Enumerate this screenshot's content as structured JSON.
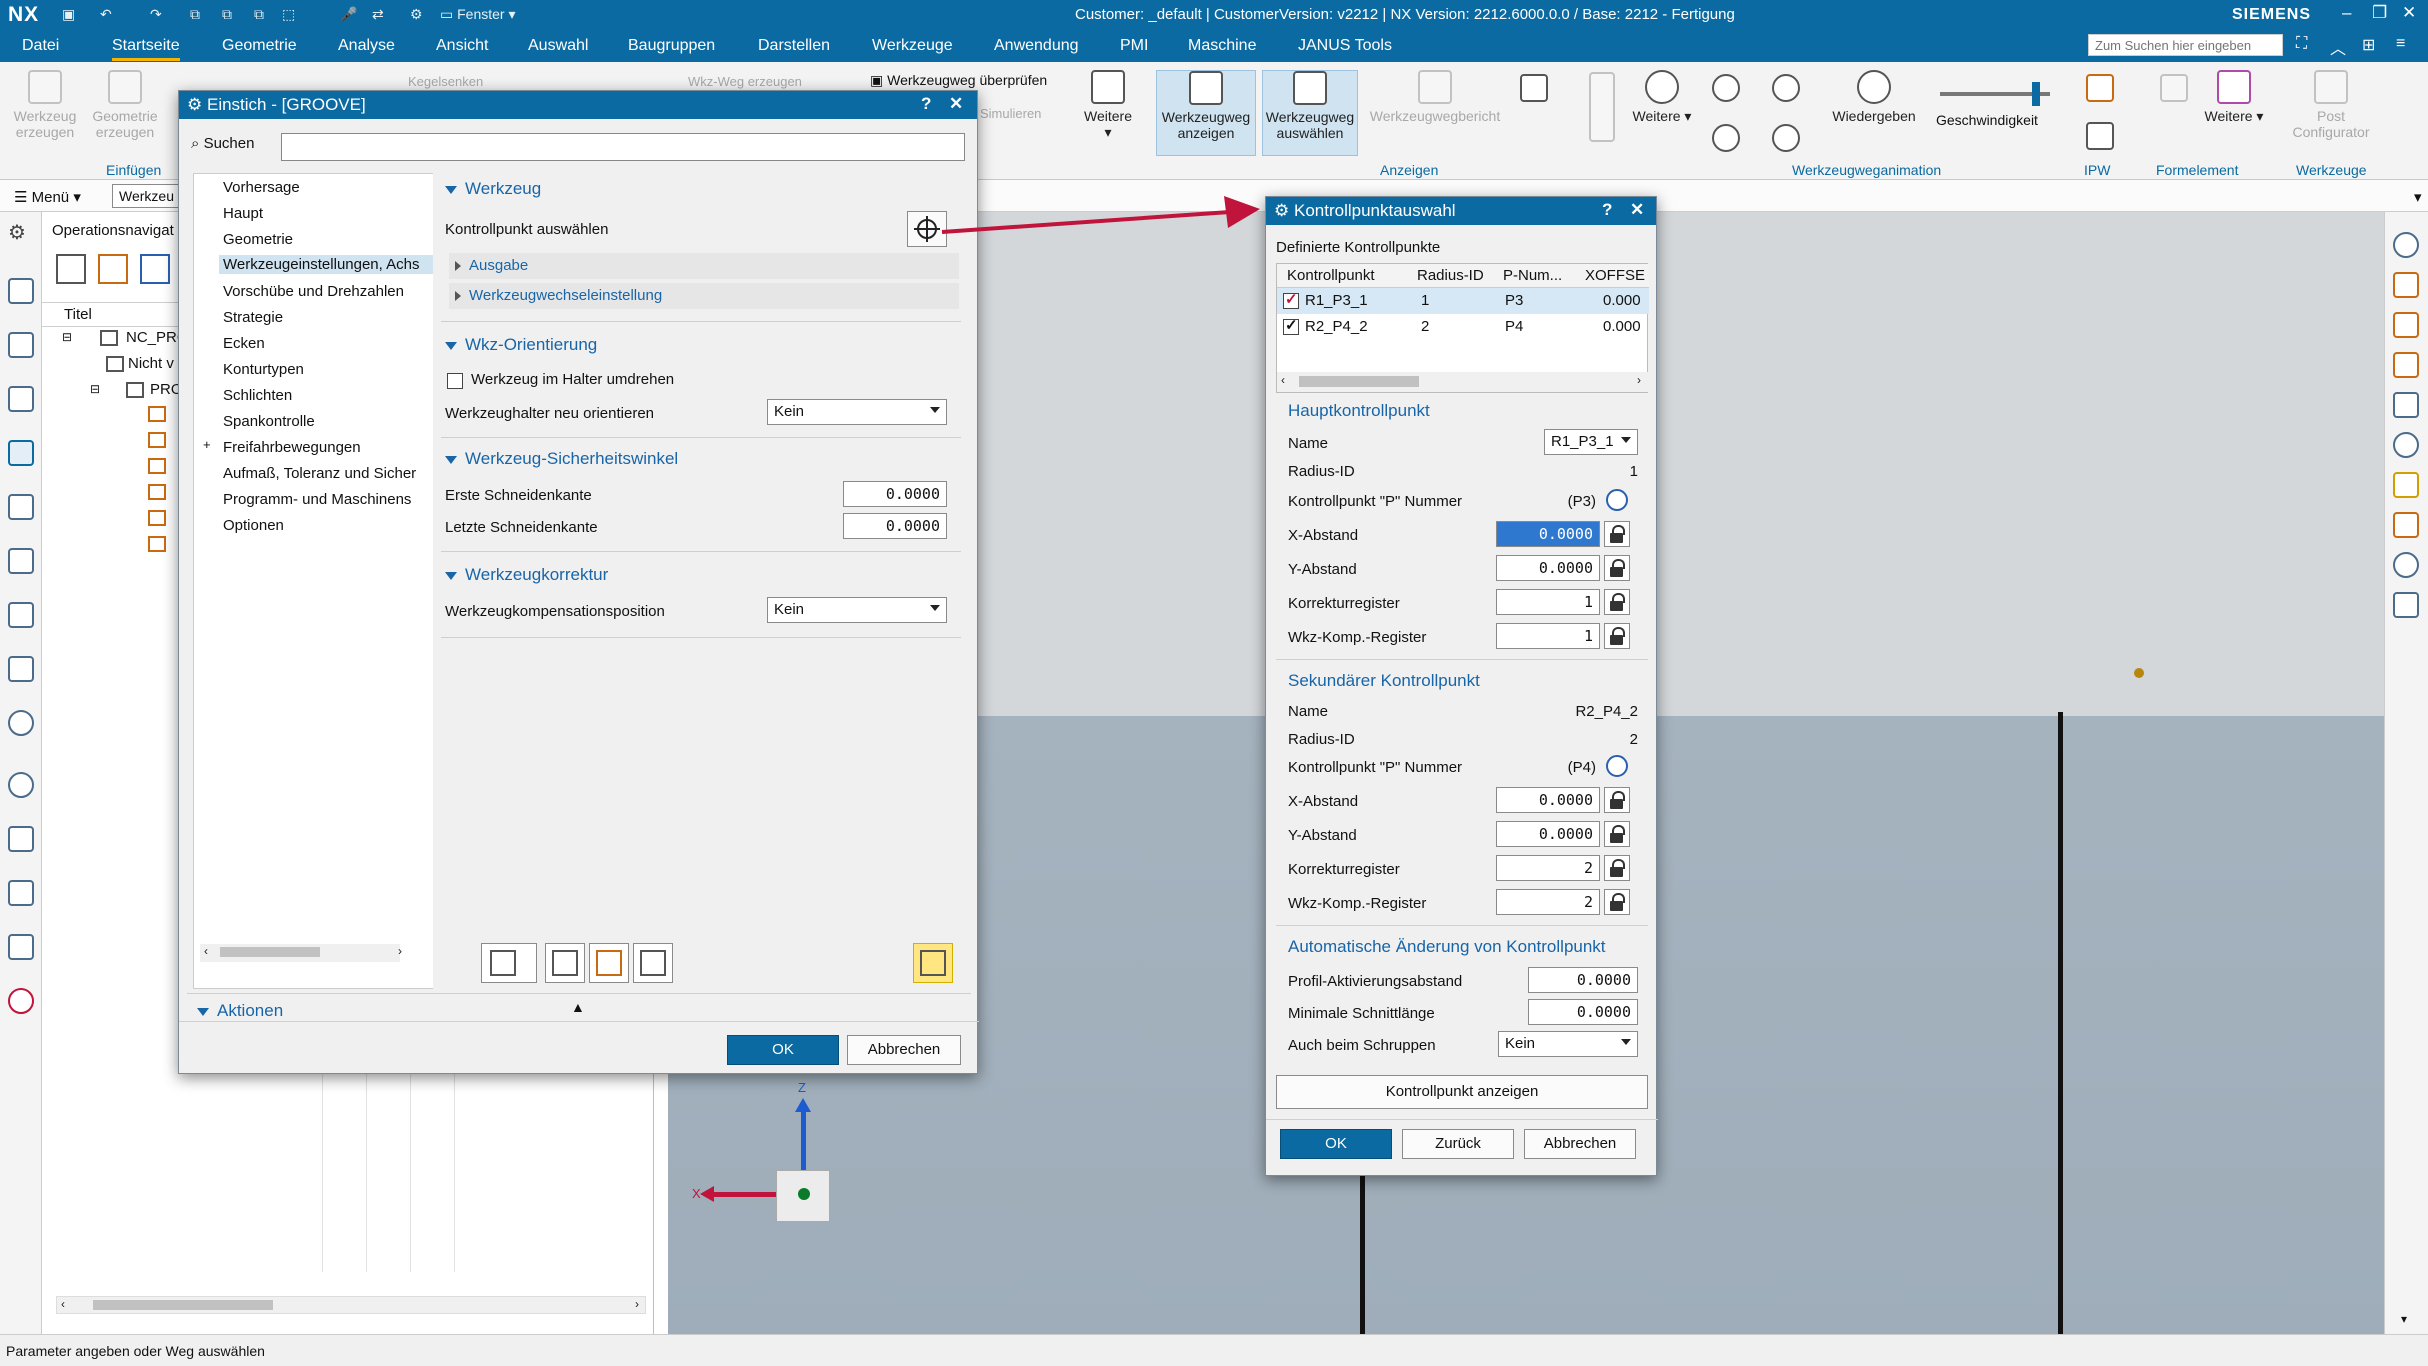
{
  "app": {
    "logo": "NX",
    "window_title": "Customer: _default | CustomerVersion: v2212 | NX Version: 2212.6000.0.0 / Base: 2212 - Fertigung",
    "brand": "SIEMENS",
    "window_menu": "Fenster"
  },
  "menubar": {
    "items": [
      "Datei",
      "Startseite",
      "Geometrie",
      "Analyse",
      "Ansicht",
      "Auswahl",
      "Baugruppen",
      "Darstellen",
      "Werkzeuge",
      "Anwendung",
      "PMI",
      "Maschine",
      "JANUS Tools"
    ],
    "search_placeholder": "Zum Suchen hier eingeben"
  },
  "ribbon": {
    "werkzeug_erzeugen": "Werkzeug erzeugen",
    "geometrie_erzeugen": "Geometrie erzeugen",
    "einfuegen_group": "Einfügen",
    "kegelsenken": "Kegelsenken",
    "wkz_weg_erzeugen": "Wkz-Weg erzeugen",
    "werkzeugweg_ueberpruefen": "Werkzeugweg überprüfen",
    "simulieren": "Simulieren",
    "weitere": "Weitere",
    "werkzeugweg_anzeigen": "Werkzeugweg anzeigen",
    "werkzeugweg_auswaehlen": "Werkzeugweg auswählen",
    "werkzeugwegbericht": "Werkzeugwegbericht",
    "anzeigen_group": "Anzeigen",
    "wiedergeben": "Wiedergeben",
    "geschwindigkeit": "Geschwindigkeit",
    "animation_group": "Werkzeugweganimation",
    "ipw_group": "IPW",
    "formelement_group": "Formelement",
    "post_configurator": "Post Configurator",
    "werkzeuge_group": "Werkzeuge"
  },
  "rowbar": {
    "menu_label": "Menü",
    "combo_value": "Werkzeu"
  },
  "navigator": {
    "title": "Operationsnavigat",
    "column": "Titel",
    "nodes": [
      "NC_PRO",
      "Nicht v",
      "PRO"
    ]
  },
  "status": {
    "message": "Parameter angeben oder Weg auswählen"
  },
  "groove_dialog": {
    "title": "Einstich - [GROOVE]",
    "help": "?",
    "close": "✕",
    "search_label": "Suchen",
    "tree": [
      "Vorhersage",
      "Haupt",
      "Geometrie",
      "Werkzeugeinstellungen, Achs",
      "Vorschübe und Drehzahlen",
      "Strategie",
      "Ecken",
      "Konturtypen",
      "Schlichten",
      "Spankontrolle",
      "Freifahrbewegungen",
      "Aufmaß, Toleranz und Sicher",
      "Programm- und Maschinens",
      "Optionen"
    ],
    "sec_werkzeug": "Werkzeug",
    "kontrollpunkt_auswaehlen": "Kontrollpunkt auswählen",
    "ausgabe": "Ausgabe",
    "werkzeugwechsel": "Werkzeugwechseleinstellung",
    "sec_orientierung": "Wkz-Orientierung",
    "halter_umdrehen": "Werkzeug im Halter umdrehen",
    "halter_neu_orientieren": "Werkzeughalter neu orientieren",
    "halter_neu_value": "Kein",
    "sec_sicherheit": "Werkzeug-Sicherheitswinkel",
    "erste_schneidenkante": "Erste Schneidenkante",
    "erste_value": "0.0000",
    "letzte_schneidenkante": "Letzte Schneidenkante",
    "letzte_value": "0.0000",
    "sec_korrektur": "Werkzeugkorrektur",
    "kompensationsposition": "Werkzeugkompensationsposition",
    "kompensation_value": "Kein",
    "sec_aktionen": "Aktionen",
    "ok": "OK",
    "abbrechen": "Abbrechen"
  },
  "kp_dialog": {
    "title": "Kontrollpunktauswahl",
    "help": "?",
    "close": "✕",
    "defined_label": "Definierte Kontrollpunkte",
    "columns": [
      "Kontrollpunkt",
      "Radius-ID",
      "P-Num...",
      "XOFFSE"
    ],
    "rows": [
      {
        "name": "R1_P3_1",
        "radius": "1",
        "pnum": "P3",
        "xoff": "0.000"
      },
      {
        "name": "R2_P4_2",
        "radius": "2",
        "pnum": "P4",
        "xoff": "0.000"
      }
    ],
    "sec_haupt": "Hauptkontrollpunkt",
    "name_label": "Name",
    "haupt_name": "R1_P3_1",
    "radius_label": "Radius-ID",
    "haupt_radius": "1",
    "pnum_label": "Kontrollpunkt \"P\" Nummer",
    "haupt_pnum": "(P3)",
    "x_label": "X-Abstand",
    "haupt_x": "0.0000",
    "y_label": "Y-Abstand",
    "haupt_y": "0.0000",
    "korr_label": "Korrekturregister",
    "haupt_korr": "1",
    "wkz_label": "Wkz-Komp.-Register",
    "haupt_wkz": "1",
    "sec_sek": "Sekundärer Kontrollpunkt",
    "sek_name": "R2_P4_2",
    "sek_radius": "2",
    "sek_pnum": "(P4)",
    "sek_x": "0.0000",
    "sek_y": "0.0000",
    "sek_korr": "2",
    "sek_wkz": "2",
    "sec_auto": "Automatische Änderung von Kontrollpunkt",
    "profil_label": "Profil-Aktivierungsabstand",
    "profil_value": "0.0000",
    "min_label": "Minimale Schnittlänge",
    "min_value": "0.0000",
    "schrupp_label": "Auch beim Schruppen",
    "schrupp_value": "Kein",
    "anzeigen_button": "Kontrollpunkt anzeigen",
    "ok": "OK",
    "zurueck": "Zurück",
    "abbrechen": "Abbrechen"
  },
  "triad": {
    "z": "Z",
    "x": "X"
  },
  "colors": {
    "accent": "#0a6aa1",
    "arrow": "#c0143c",
    "tab_underline": "#f5b400"
  }
}
